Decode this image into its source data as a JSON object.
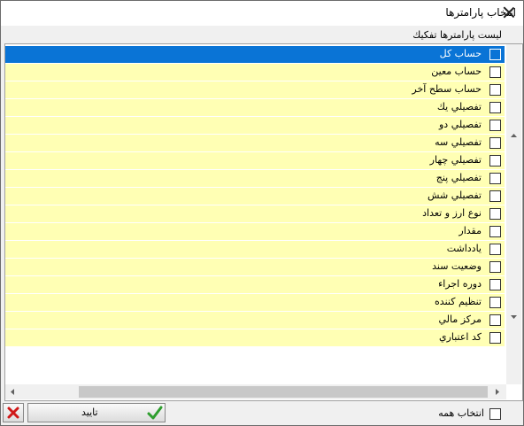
{
  "window": {
    "title": "انتخاب پارامترها"
  },
  "list": {
    "label": "لیست پارامترها تفکیك",
    "items": [
      {
        "label": "حساب كل",
        "selected": true,
        "checked": false
      },
      {
        "label": "حساب معين",
        "selected": false,
        "checked": false
      },
      {
        "label": "حساب سطح آخر",
        "selected": false,
        "checked": false
      },
      {
        "label": "تفصيلي يك",
        "selected": false,
        "checked": false
      },
      {
        "label": "تفصيلي دو",
        "selected": false,
        "checked": false
      },
      {
        "label": "تفصيلي سه",
        "selected": false,
        "checked": false
      },
      {
        "label": "تفصيلي چهار",
        "selected": false,
        "checked": false
      },
      {
        "label": "تفصيلي پنج",
        "selected": false,
        "checked": false
      },
      {
        "label": "تفصيلي شش",
        "selected": false,
        "checked": false
      },
      {
        "label": "نوع ارز و تعداد",
        "selected": false,
        "checked": false
      },
      {
        "label": "مقدار",
        "selected": false,
        "checked": false
      },
      {
        "label": "يادداشت",
        "selected": false,
        "checked": false
      },
      {
        "label": "وضعيت سند",
        "selected": false,
        "checked": false
      },
      {
        "label": "دوره اجراء",
        "selected": false,
        "checked": false
      },
      {
        "label": "تنظيم كننده",
        "selected": false,
        "checked": false
      },
      {
        "label": "مركز مالي",
        "selected": false,
        "checked": false
      },
      {
        "label": "كد اعتباري",
        "selected": false,
        "checked": false
      }
    ]
  },
  "footer": {
    "confirm_label": "تاييد",
    "select_all_label": "انتخاب همه"
  },
  "colors": {
    "row_bg": "#ffffb4",
    "selected_bg": "#0a74d6",
    "confirm_icon": "#2e9e2e",
    "cancel_icon": "#d01818"
  },
  "icons": {
    "confirm": "checkmark-icon",
    "cancel": "x-icon"
  }
}
